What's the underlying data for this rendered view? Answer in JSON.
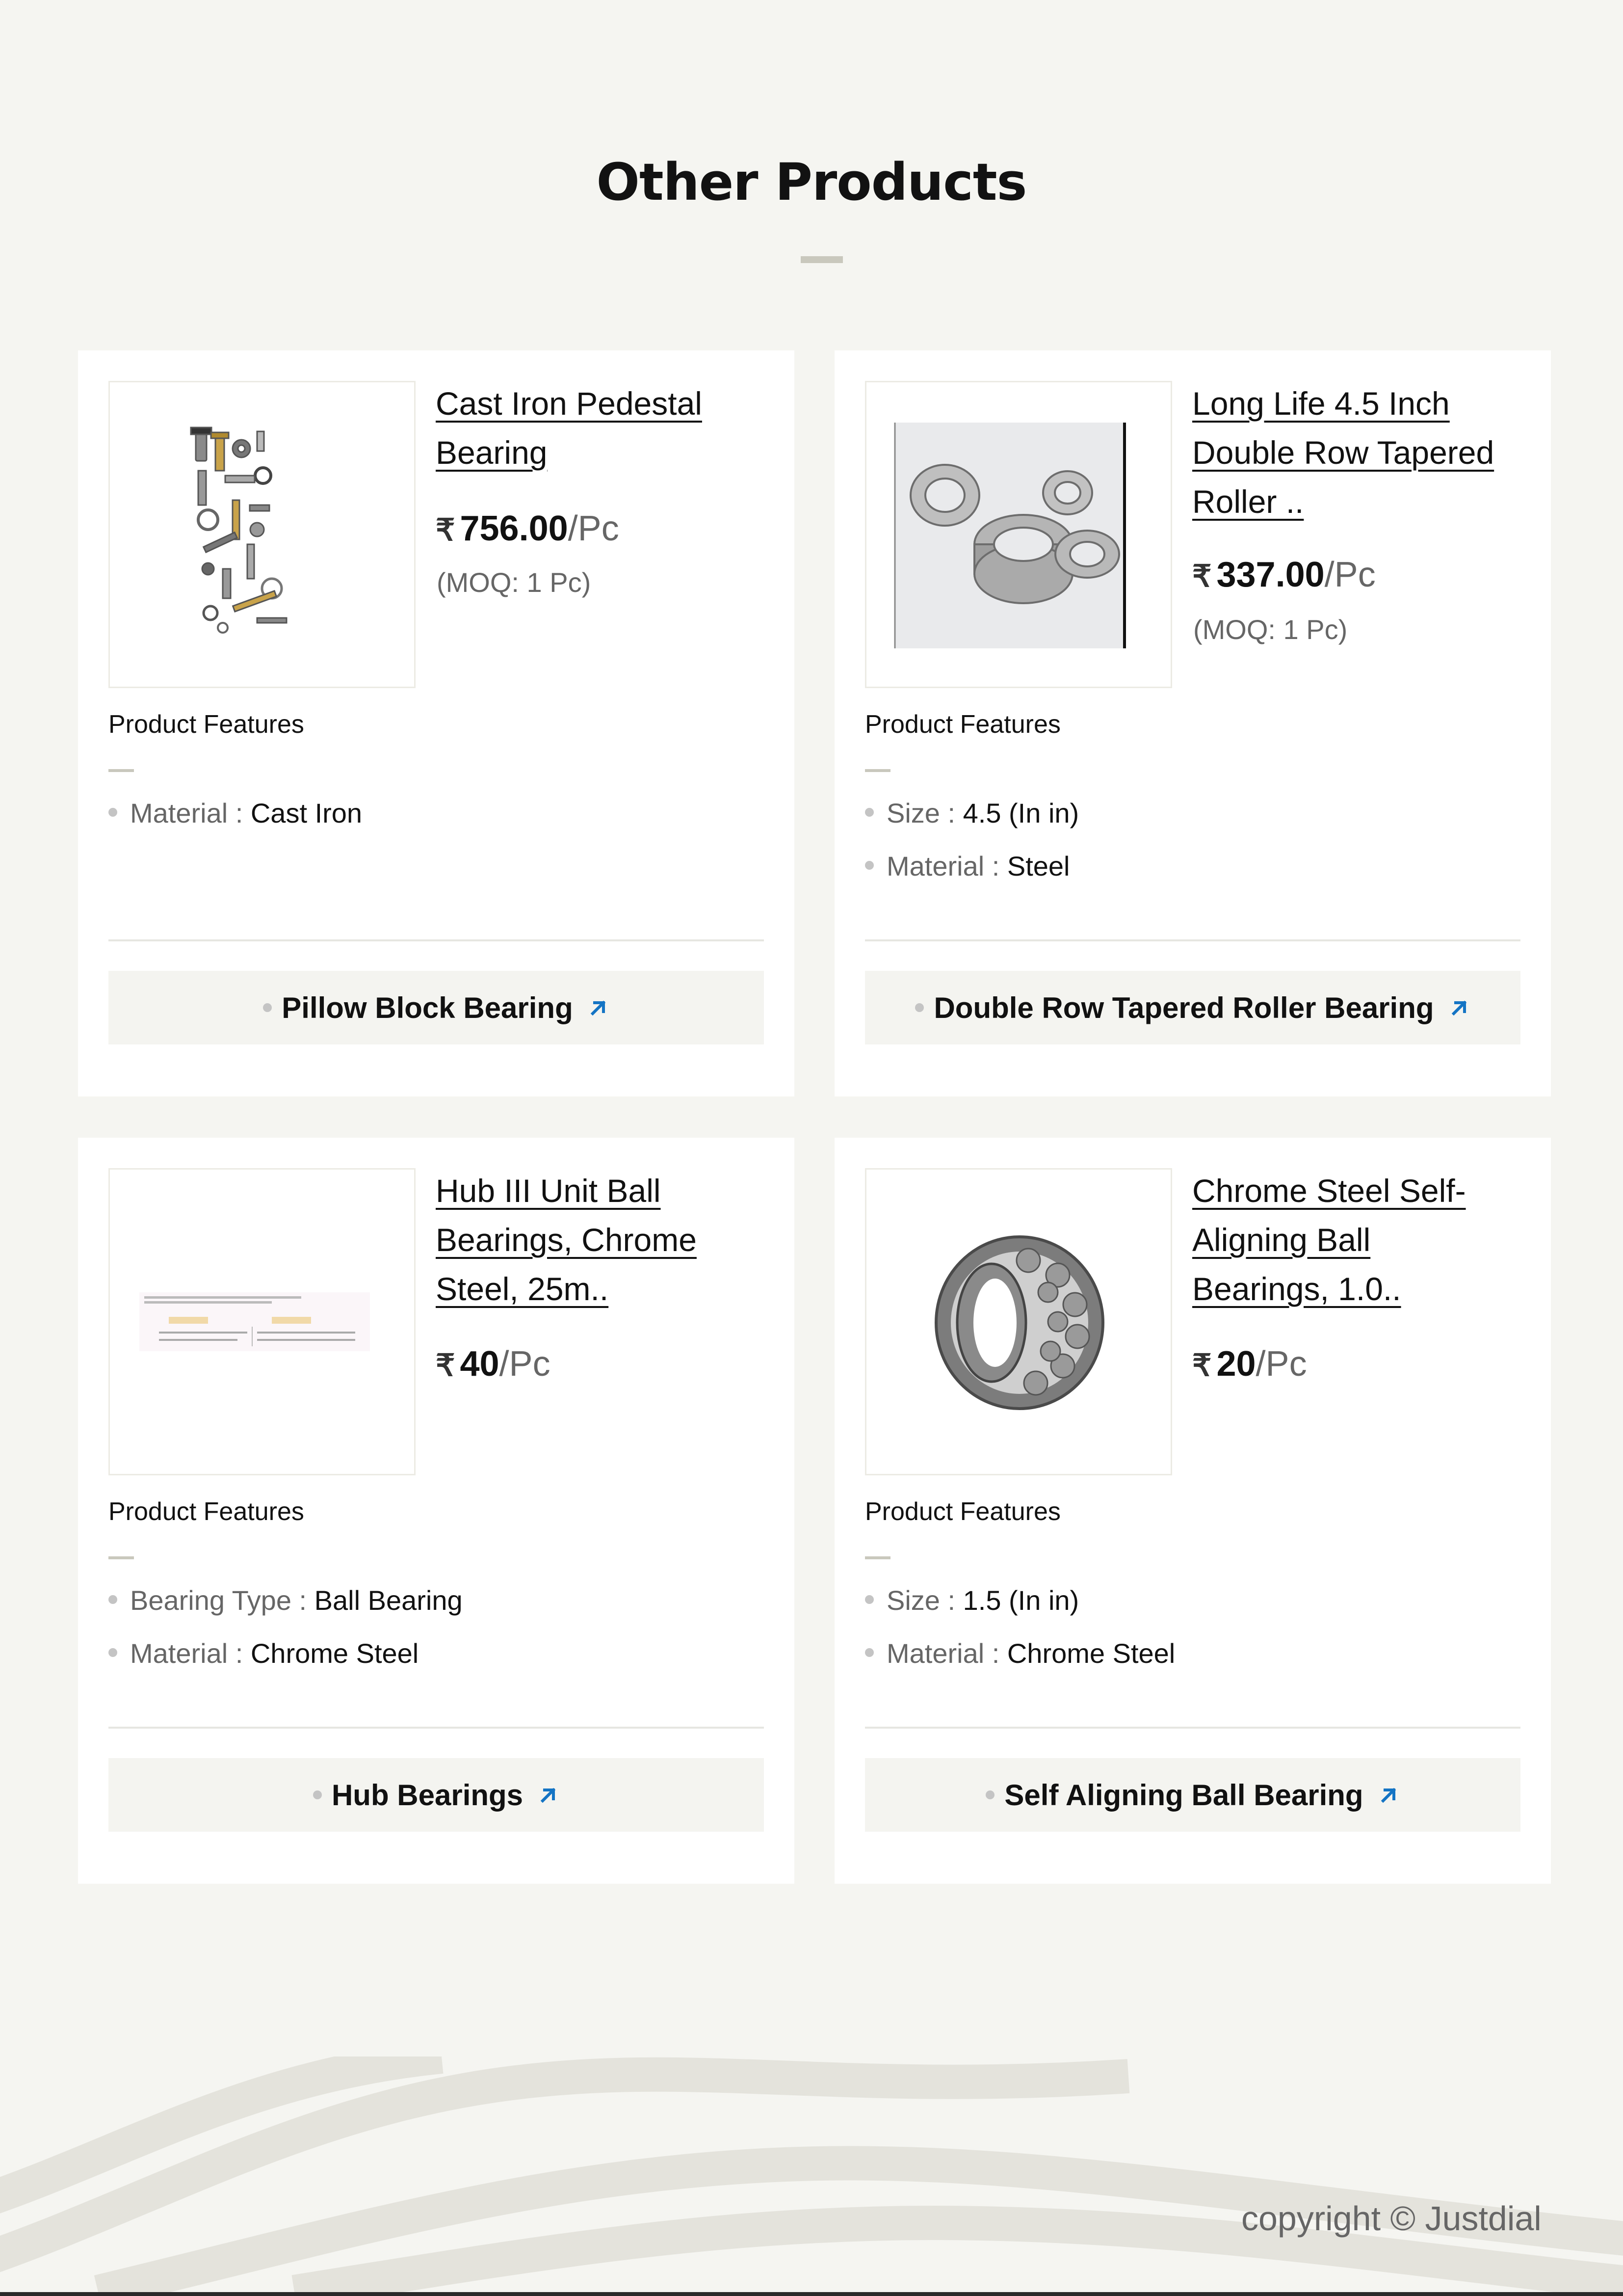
{
  "page": {
    "title": "Other Products",
    "copyright": "copyright © Justdial"
  },
  "colors": {
    "background": "#f5f5f1",
    "card": "#ffffff",
    "accent_arrow": "#1474c4",
    "muted_text": "#666666",
    "rule": "#c9c8bd"
  },
  "features_heading": "Product Features",
  "currency_symbol": "₹",
  "products": [
    {
      "name": "Cast Iron Pedestal Bearing",
      "image_icon": "nuts-and-bolts-image",
      "price": "756.00",
      "unit": "/Pc",
      "moq": "(MOQ: 1 Pc)",
      "features": [
        {
          "label": "Material",
          "sep": " : ",
          "value": "Cast Iron"
        }
      ],
      "category": "Pillow Block Bearing"
    },
    {
      "name": "Long Life 4.5 Inch Double Row Tapered Roller ..",
      "image_icon": "tapered-roller-bearings-image",
      "price": "337.00",
      "unit": "/Pc",
      "moq": "(MOQ: 1 Pc)",
      "features": [
        {
          "label": "Size",
          "sep": " : ",
          "value": "4.5 (In in)"
        },
        {
          "label": "Material",
          "sep": " : ",
          "value": "Steel"
        }
      ],
      "category": "Double Row Tapered Roller Bearing"
    },
    {
      "name": "Hub III Unit Ball Bearings, Chrome Steel, 25m..",
      "image_icon": "specification-table-image",
      "price": "40",
      "unit": "/Pc",
      "moq": "",
      "features": [
        {
          "label": "Bearing Type",
          "sep": " : ",
          "value": "Ball Bearing"
        },
        {
          "label": "Material",
          "sep": " : ",
          "value": "Chrome Steel"
        }
      ],
      "category": "Hub Bearings"
    },
    {
      "name": "Chrome Steel Self-Aligning Ball Bearings, 1.0..",
      "image_icon": "self-aligning-ball-bearing-image",
      "price": "20",
      "unit": "/Pc",
      "moq": "",
      "features": [
        {
          "label": "Size",
          "sep": " : ",
          "value": "1.5 (In in)"
        },
        {
          "label": "Material",
          "sep": " : ",
          "value": "Chrome Steel"
        }
      ],
      "category": "Self Aligning Ball Bearing"
    }
  ]
}
